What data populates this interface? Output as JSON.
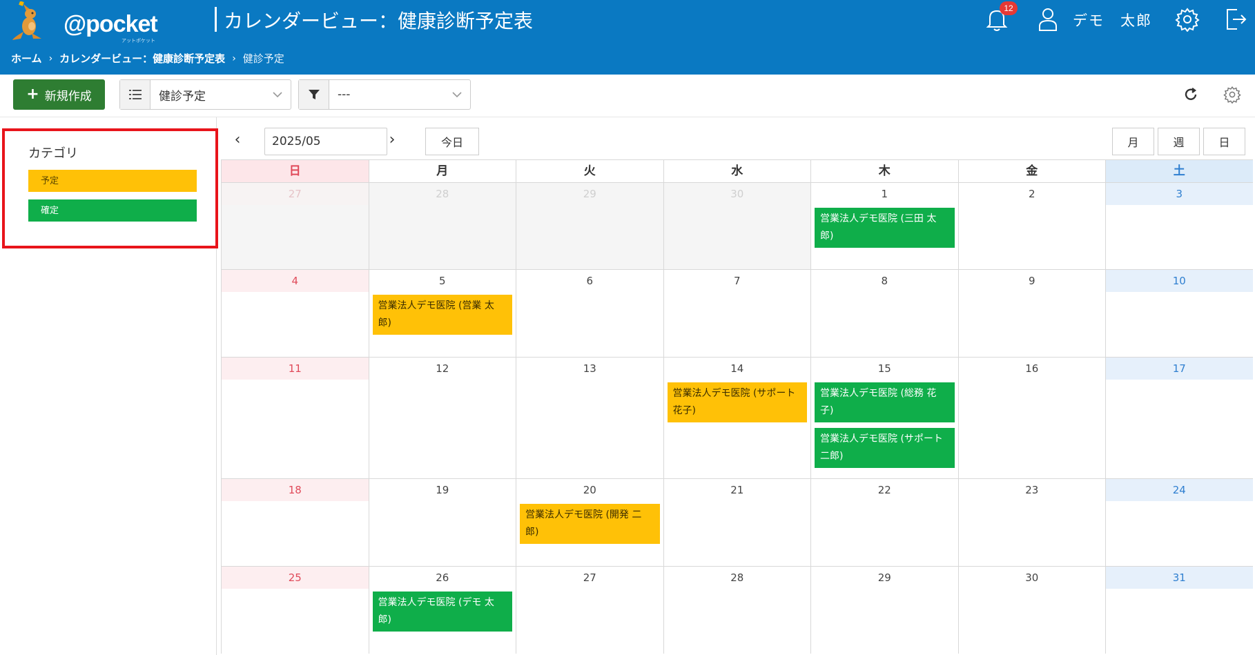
{
  "header": {
    "logo_text": "@pocket",
    "logo_sub": "アットポケット",
    "page_title": "カレンダービュー：健康診断予定表",
    "notification_count": "12",
    "user_name": "デモ　太郎",
    "breadcrumb": {
      "home": "ホーム",
      "parent": "カレンダービュー：健康診断予定表",
      "current": "健診予定"
    }
  },
  "toolbar": {
    "new_label": "新規作成",
    "view_select_value": "健診予定",
    "filter_select_value": "---"
  },
  "categories": {
    "title": "カテゴリ",
    "items": [
      {
        "label": "予定",
        "color": "#ffc107"
      },
      {
        "label": "確定",
        "color": "#0fae4a"
      }
    ]
  },
  "calendar": {
    "month": "2025/05",
    "today_label": "今日",
    "view_modes": [
      "月",
      "週",
      "日"
    ],
    "weekdays": [
      "日",
      "月",
      "火",
      "水",
      "木",
      "金",
      "土"
    ],
    "weeks": [
      [
        "27",
        "28",
        "29",
        "30",
        "1",
        "2",
        "3"
      ],
      [
        "4",
        "5",
        "6",
        "7",
        "8",
        "9",
        "10"
      ],
      [
        "11",
        "12",
        "13",
        "14",
        "15",
        "16",
        "17"
      ],
      [
        "18",
        "19",
        "20",
        "21",
        "22",
        "23",
        "24"
      ],
      [
        "25",
        "26",
        "27",
        "28",
        "29",
        "30",
        "31"
      ]
    ],
    "events": {
      "may1": "営業法人デモ医院 (三田 太郎)",
      "may5": "営業法人デモ医院 (営業 太郎)",
      "may14": "営業法人デモ医院 (サポート　花子)",
      "may15a": "営業法人デモ医院 (総務 花子)",
      "may15b": "営業法人デモ医院 (サポート　二郎)",
      "may20": "営業法人デモ医院 (開発 二郎)",
      "may26": "営業法人デモ医院 (デモ 太郎)"
    }
  }
}
